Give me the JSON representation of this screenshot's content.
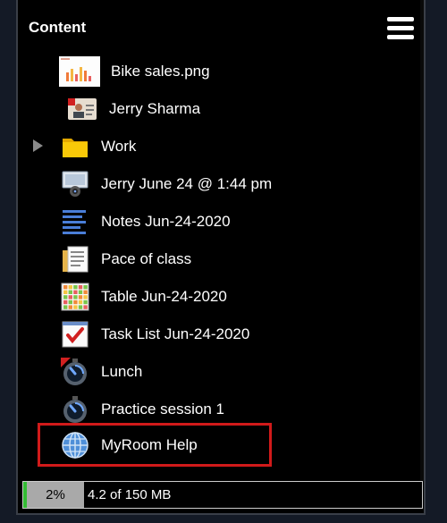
{
  "header": {
    "title": "Content",
    "menu_icon": "hamburger-menu-icon"
  },
  "items": [
    {
      "label": "Bike sales.png",
      "icon": "image-thumbnail-icon"
    },
    {
      "label": "Jerry Sharma",
      "icon": "contact-card-icon"
    },
    {
      "label": "Work",
      "icon": "folder-icon",
      "collapsed": true
    },
    {
      "label": "Jerry June 24 @ 1:44 pm",
      "icon": "webcam-recording-icon"
    },
    {
      "label": "Notes Jun-24-2020",
      "icon": "notes-icon"
    },
    {
      "label": "Pace of class",
      "icon": "document-pages-icon"
    },
    {
      "label": "Table Jun-24-2020",
      "icon": "table-grid-icon"
    },
    {
      "label": "Task List Jun-24-2020",
      "icon": "task-checklist-icon"
    },
    {
      "label": "Lunch",
      "icon": "stopwatch-icon"
    },
    {
      "label": "Practice session 1",
      "icon": "stopwatch-icon"
    },
    {
      "label": "MyRoom Help",
      "icon": "globe-icon",
      "highlighted": true
    }
  ],
  "storage": {
    "percent_label": "2%",
    "used_fraction": 0.02,
    "usage_text": "4.2 of 150 MB"
  },
  "colors": {
    "panel_bg": "#000000",
    "page_bg": "#141a26",
    "highlight_border": "#d11a1a",
    "storage_fill": "#33bb33"
  }
}
